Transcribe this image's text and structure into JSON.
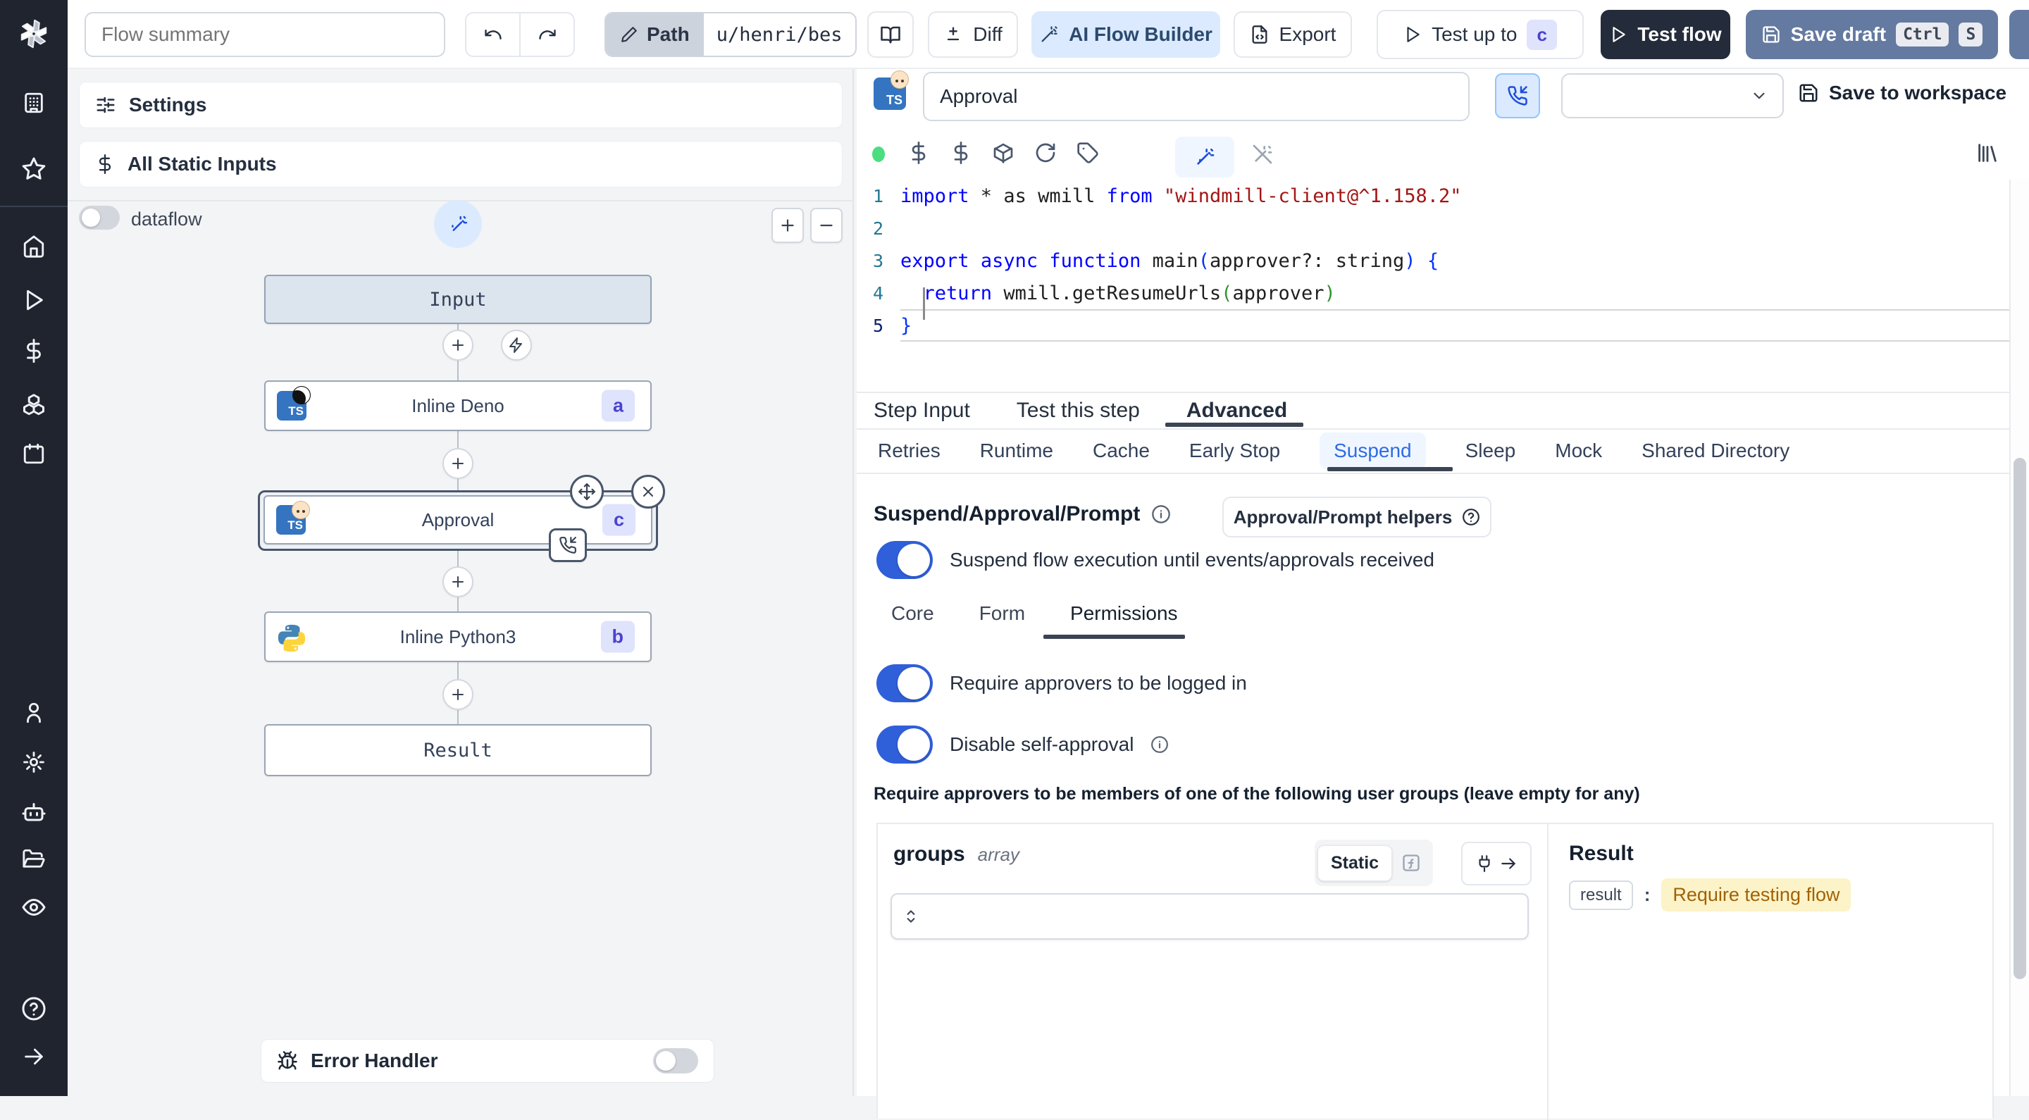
{
  "colors": {
    "accent_blue": "#305fda",
    "active_tab_blue": "#2e6be5",
    "ai_button_bg": "#dbeafe",
    "save_draft_bg": "#647aa0",
    "test_flow_bg": "#242b3a",
    "badge_bg": "#dfe3fc",
    "badge_text": "#4b43ce",
    "status_dot_green": "#4ade80",
    "result_highlight_bg": "#fdf3c8",
    "result_highlight_text": "#a16207",
    "rail_bg": "#20242e"
  },
  "topbar": {
    "flow_summary_placeholder": "Flow summary",
    "path_label": "Path",
    "path_value": "u/henri/bes",
    "diff_label": "Diff",
    "ai_flow_builder_label": "AI Flow Builder",
    "export_label": "Export",
    "test_up_to_label": "Test up to",
    "test_up_to_step": "c",
    "test_flow_label": "Test flow",
    "save_draft_label": "Save draft",
    "kbd_ctrl": "Ctrl",
    "kbd_s": "S"
  },
  "flow_panel": {
    "settings_label": "Settings",
    "all_static_inputs_label": "All Static Inputs",
    "dataflow_label": "dataflow",
    "graph": {
      "input_label": "Input",
      "result_label": "Result",
      "nodes": [
        {
          "label": "Inline Deno",
          "badge": "a",
          "lang": "deno-typescript"
        },
        {
          "label": "Approval",
          "badge": "c",
          "lang": "bun-typescript",
          "selected": true
        },
        {
          "label": "Inline Python3",
          "badge": "b",
          "lang": "python3"
        }
      ]
    },
    "error_handler_label": "Error Handler"
  },
  "step_editor": {
    "step_name_value": "Approval",
    "save_to_workspace_label": "Save to workspace",
    "code": {
      "language": "typescript",
      "lines": [
        [
          {
            "c": "kw",
            "t": "import"
          },
          {
            "c": "pl",
            "t": " * as wmill "
          },
          {
            "c": "kw",
            "t": "from"
          },
          {
            "c": "pl",
            "t": " "
          },
          {
            "c": "str",
            "t": "\"windmill-client@^1.158.2\""
          }
        ],
        [],
        [
          {
            "c": "kw",
            "t": "export"
          },
          {
            "c": "pl",
            "t": " "
          },
          {
            "c": "kw",
            "t": "async"
          },
          {
            "c": "pl",
            "t": " "
          },
          {
            "c": "kw",
            "t": "function"
          },
          {
            "c": "pl",
            "t": " main"
          },
          {
            "c": "b1",
            "t": "("
          },
          {
            "c": "pl",
            "t": "approver?: string"
          },
          {
            "c": "b1",
            "t": ")"
          },
          {
            "c": "pl",
            "t": " "
          },
          {
            "c": "b1",
            "t": "{"
          }
        ],
        [
          {
            "c": "pl",
            "t": "  "
          },
          {
            "c": "kw",
            "t": "return"
          },
          {
            "c": "pl",
            "t": " wmill.getResumeUrls"
          },
          {
            "c": "b2",
            "t": "("
          },
          {
            "c": "pl",
            "t": "approver"
          },
          {
            "c": "b2",
            "t": ")"
          }
        ],
        [
          {
            "c": "b1",
            "t": "}"
          }
        ]
      ]
    },
    "tabs": [
      "Step Input",
      "Test this step",
      "Advanced"
    ],
    "active_tab": "Advanced",
    "advanced_tabs": [
      "Retries",
      "Runtime",
      "Cache",
      "Early Stop",
      "Suspend",
      "Sleep",
      "Mock",
      "Shared Directory"
    ],
    "active_advanced_tab": "Suspend",
    "suspend": {
      "heading": "Suspend/Approval/Prompt",
      "helpers_button_label": "Approval/Prompt helpers",
      "suspend_toggle_label": "Suspend flow execution until events/approvals received",
      "permission_tabs": [
        "Core",
        "Form",
        "Permissions"
      ],
      "active_permission_tab": "Permissions",
      "require_login_label": "Require approvers to be logged in",
      "disable_self_approval_label": "Disable self-approval",
      "groups_hint": "Require approvers to be members of one of the following user groups (leave empty for any)",
      "groups_field_name": "groups",
      "groups_field_type": "array",
      "static_label": "Static",
      "result_heading": "Result",
      "result_key": "result",
      "result_value": "Require testing flow"
    }
  }
}
